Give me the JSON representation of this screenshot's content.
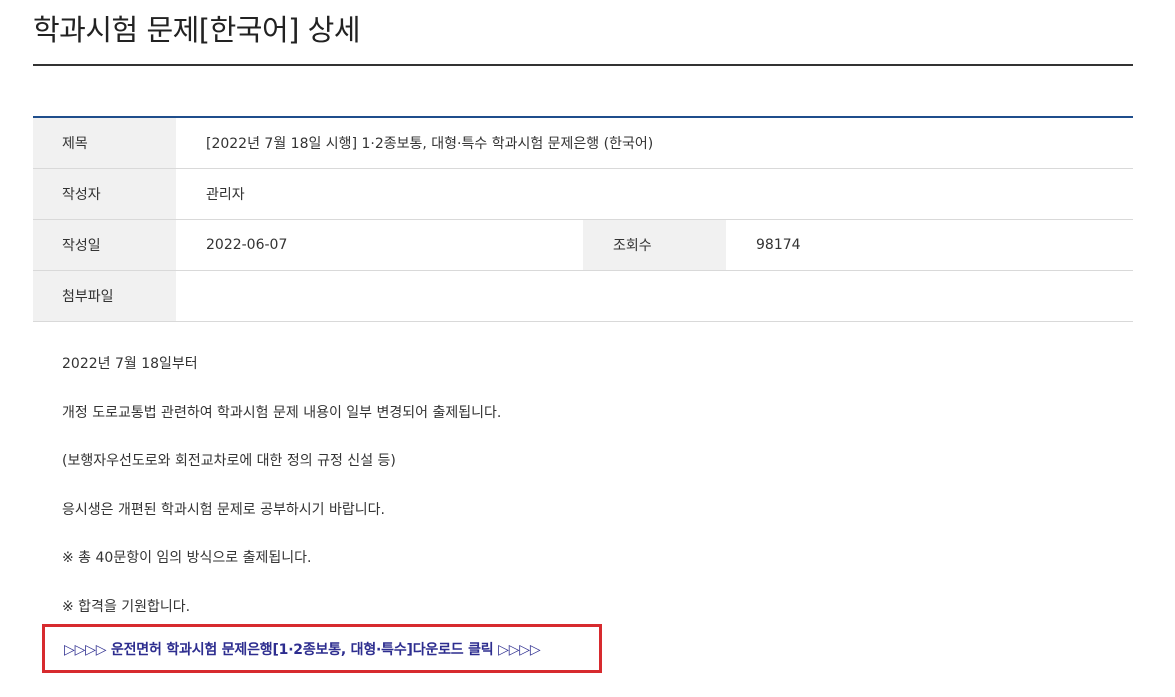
{
  "page": {
    "title": "학과시험 문제[한국어] 상세"
  },
  "info": {
    "subject_label": "제목",
    "subject_value": "[2022년 7월 18일 시행] 1·2종보통, 대형·특수 학과시험 문제은행 (한국어)",
    "author_label": "작성자",
    "author_value": "관리자",
    "date_label": "작성일",
    "date_value": "2022-06-07",
    "views_label": "조회수",
    "views_value": "98174",
    "attachment_label": "첨부파일",
    "attachment_value": ""
  },
  "content": {
    "lines": [
      "2022년 7월 18일부터",
      "개정 도로교통법 관련하여 학과시험 문제 내용이 일부 변경되어 출제됩니다.",
      "(보행자우선도로와 회전교차로에 대한 정의 규정 신설 등)",
      "응시생은 개편된 학과시험 문제로 공부하시기 바랍니다.",
      "※ 총 40문항이 임의 방식으로 출제됩니다.",
      "※ 합격을 기원합니다."
    ],
    "download_link": "▷▷▷▷ 운전면허 학과시험 문제은행[1·2종보통, 대형·특수]다운로드 클릭 ▷▷▷▷"
  },
  "colors": {
    "table_top_border": "#1f4e8c",
    "label_bg": "#f1f1f1",
    "highlight_border": "#d72a2e",
    "link_color": "#2d2d8f"
  }
}
